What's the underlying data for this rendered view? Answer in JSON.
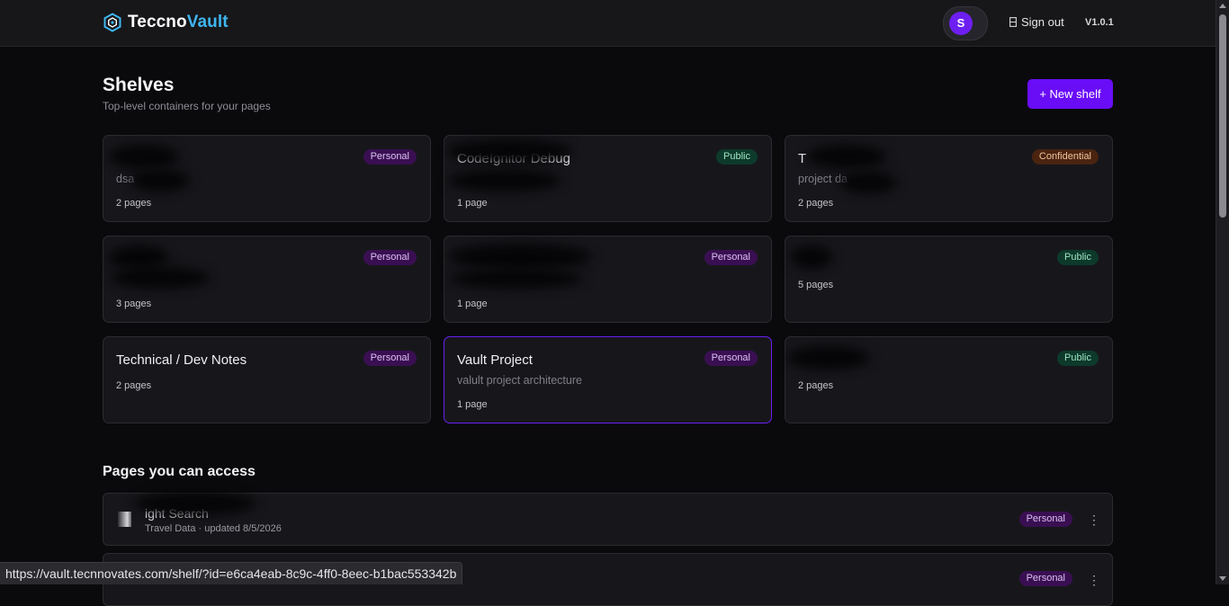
{
  "app": {
    "logo_part1": "Teccno",
    "logo_part2": "Vault",
    "version": "V1.0.1"
  },
  "user": {
    "avatar_initial": "S",
    "signout_label": "Sign out",
    "signout_icon": "door-icon"
  },
  "header": {
    "title": "Shelves",
    "subtitle": "Top-level containers for your pages",
    "new_shelf_label": "+ New shelf"
  },
  "shelves": [
    {
      "title": "",
      "desc": "dsa",
      "count": "2 pages",
      "badge": "Personal"
    },
    {
      "title": "CodeIgnitor Debug",
      "desc": "",
      "count": "1 page",
      "badge": "Public"
    },
    {
      "title": "T",
      "desc": "project da",
      "count": "2 pages",
      "badge": "Confidential"
    },
    {
      "title": "",
      "desc": "",
      "count": "3 pages",
      "badge": "Personal"
    },
    {
      "title": "",
      "desc": "",
      "count": "1 page",
      "badge": "Personal"
    },
    {
      "title": "",
      "desc": "",
      "count": "5 pages",
      "badge": "Public"
    },
    {
      "title": "Technical / Dev Notes",
      "desc": "",
      "count": "2 pages",
      "badge": "Personal"
    },
    {
      "title": "Vault Project",
      "desc": "valult project architecture",
      "count": "1 page",
      "badge": "Personal"
    },
    {
      "title": "",
      "desc": "",
      "count": "2 pages",
      "badge": "Public"
    }
  ],
  "pages_section": {
    "title": "Pages you can access",
    "items": [
      {
        "title": "ight Search",
        "meta": "Travel Data · updated 8/5/2026",
        "badge": "Personal"
      },
      {
        "title": "",
        "meta": "",
        "badge": "Personal"
      }
    ]
  },
  "status_url": "https://vault.tecnnovates.com/shelf/?id=e6ca4eab-8c9c-4ff0-8eec-b1bac553342b",
  "colors": {
    "accent": "#6a0df7",
    "logo_accent": "#3fb6f0",
    "active_border": "#6a1ff0"
  }
}
